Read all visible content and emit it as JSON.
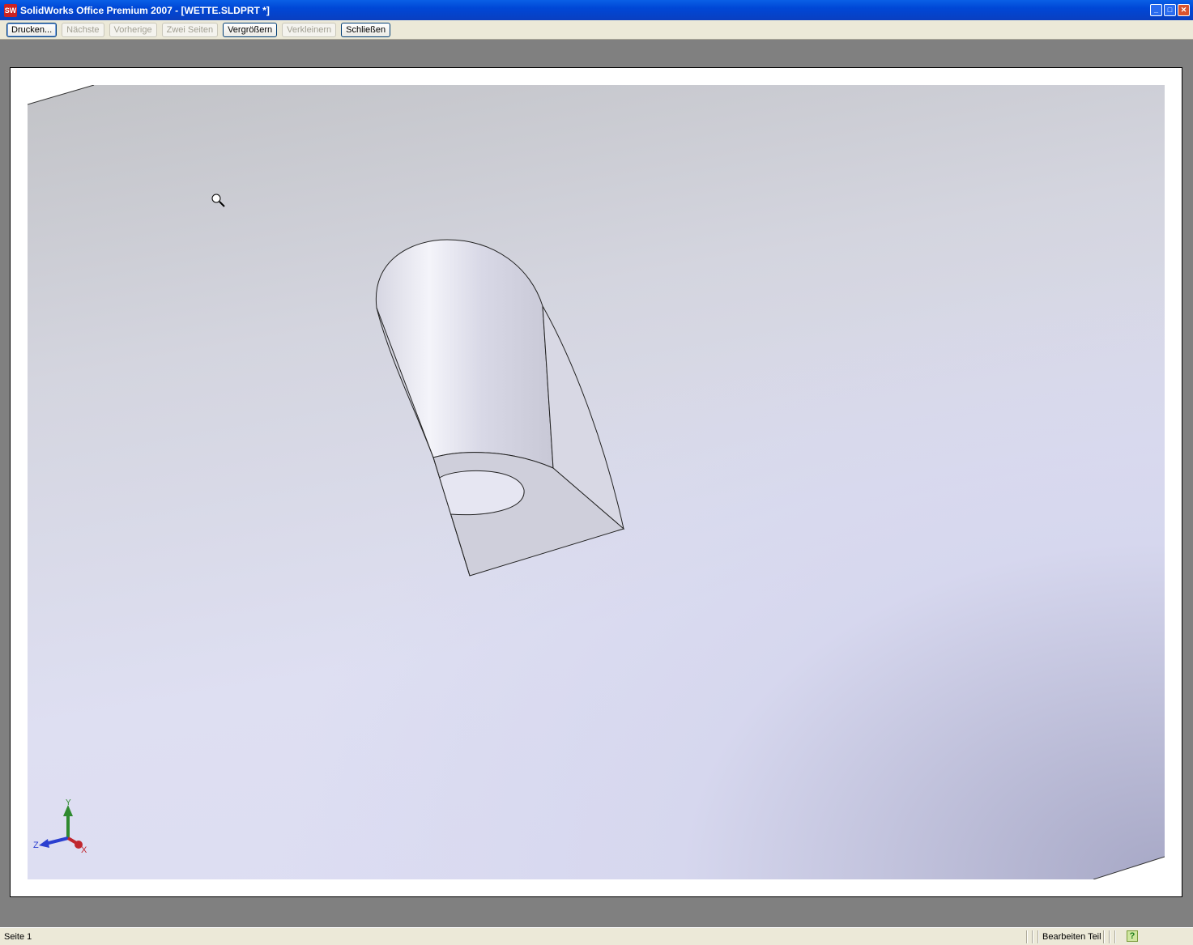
{
  "window": {
    "title": "SolidWorks Office Premium 2007 - [WETTE.SLDPRT *]",
    "logo": "SW"
  },
  "toolbar": {
    "buttons": [
      {
        "label": "Drucken...",
        "enabled": true
      },
      {
        "label": "Nächste",
        "enabled": false
      },
      {
        "label": "Vorherige",
        "enabled": false
      },
      {
        "label": "Zwei Seiten",
        "enabled": false
      },
      {
        "label": "Vergrößern",
        "enabled": true
      },
      {
        "label": "Verkleinern",
        "enabled": false
      },
      {
        "label": "Schließen",
        "enabled": true
      }
    ]
  },
  "triad": {
    "x": "X",
    "y": "Y",
    "z": "Z"
  },
  "status": {
    "page": "Seite 1",
    "mode": "Bearbeiten Teil",
    "help": "?"
  },
  "colors": {
    "title": "#0054e3",
    "x_axis": "#c0262d",
    "y_axis": "#2f8a2f",
    "z_axis": "#2b3fd0"
  }
}
